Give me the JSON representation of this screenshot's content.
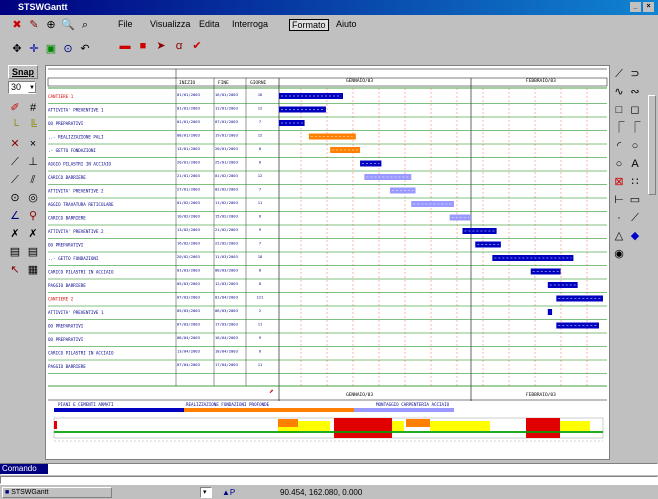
{
  "window": {
    "title": "STSWGantt"
  },
  "menu": [
    "File",
    "Visualizza",
    "Edita",
    "Interroga",
    "Formato",
    "Aiuto"
  ],
  "menu_active_index": 4,
  "snap": {
    "label": "Snap",
    "value": "30"
  },
  "table": {
    "headers": [
      "INIZIO",
      "FINE",
      "GIORNI"
    ],
    "rows": [
      {
        "task": "CANTIERE 1",
        "red": true,
        "start": "01/01/2003",
        "end": "16/01/2003",
        "days": "16"
      },
      {
        "task": "ATTIVITA' PREVENTIVE 1",
        "start": "01/01/2003",
        "end": "12/01/2003",
        "days": "12"
      },
      {
        "task": "OO PREPARATIVI",
        "start": "01/01/2003",
        "end": "07/01/2003",
        "days": "7"
      },
      {
        "task": "..- REALIZZAZIONE PALI",
        "start": "08/01/2003",
        "end": "19/01/2003",
        "days": "12"
      },
      {
        "task": ".- GETTO FONDAZIONI",
        "start": "13/01/2003",
        "end": "20/01/2003",
        "days": "8"
      },
      {
        "task": "AGGIO PILASTRI IN ACCIAIO",
        "start": "20/01/2003",
        "end": "25/01/2003",
        "days": "6"
      },
      {
        "task": "CARICO BARRIERE",
        "start": "21/01/2003",
        "end": "01/02/2003",
        "days": "12"
      },
      {
        "task": "ATTIVITA' PREVENTIVE 2",
        "start": "27/01/2003",
        "end": "02/02/2003",
        "days": "7"
      },
      {
        "task": "AGGIO TRAVATURA RETICOLARE",
        "start": "01/02/2003",
        "end": "11/02/2003",
        "days": "11"
      },
      {
        "task": "CARICO BARRIERE",
        "start": "10/02/2003",
        "end": "15/02/2003",
        "days": "6"
      },
      {
        "task": "ATTIVITA' PREVENTIVE 2",
        "start": "13/02/2003",
        "end": "21/02/2003",
        "days": "9"
      },
      {
        "task": "OO PREPARATIVI",
        "start": "16/02/2003",
        "end": "22/02/2003",
        "days": "7"
      },
      {
        "task": "..- GETTO FONDAZIONI",
        "start": "20/02/2003",
        "end": "11/03/2003",
        "days": "18"
      },
      {
        "task": "CARICO PILASTRI IN ACCIAIO",
        "start": "01/03/2003",
        "end": "08/03/2003",
        "days": "8"
      },
      {
        "task": "PAGGIO BARRIERE",
        "start": "05/03/2003",
        "end": "12/03/2003",
        "days": "8"
      },
      {
        "task": "CANTIERE 2",
        "red": true,
        "start": "07/03/2003",
        "end": "01/04/2003",
        "days": "121"
      },
      {
        "task": "ATTIVITA' PREVENTIVE 1",
        "start": "05/03/2003",
        "end": "06/03/2003",
        "days": "2"
      },
      {
        "task": "OO PREPARATIVI",
        "start": "07/03/2003",
        "end": "17/03/2003",
        "days": "11"
      },
      {
        "task": "OO PREPARATIVI",
        "start": "08/04/2003",
        "end": "16/04/2003",
        "days": "9"
      },
      {
        "task": "CARICO PILASTRI IN ACCIAIO",
        "start": "13/04/2003",
        "end": "18/04/2003",
        "days": "6"
      },
      {
        "task": "PAGGIO BARRIERE",
        "start": "07/04/2003",
        "end": "17/04/2003",
        "days": "11"
      }
    ]
  },
  "timeline": {
    "months": [
      "GENNAIO/03",
      "FEBBRAIO/03"
    ]
  },
  "bottom_labels": [
    "PIANI E CEMENTI ARMATI",
    "REALIZZAZIONE FONDAZIONI PROFONDE",
    "MONTAGGIO CARPENTERIA ACCIAIO"
  ],
  "command": {
    "label": "Comando",
    "value": ""
  },
  "taskbar": {
    "task1": "STSWGantt",
    "coords": "90.454, 162.080, 0.000"
  },
  "colors": {
    "titlebar": "#000080",
    "bar_blue": "#0000c0",
    "bar_orange": "#ff8000",
    "bar_light": "#9999ff",
    "red": "#e00000",
    "yellow": "#ffff00",
    "green": "#00a000"
  }
}
